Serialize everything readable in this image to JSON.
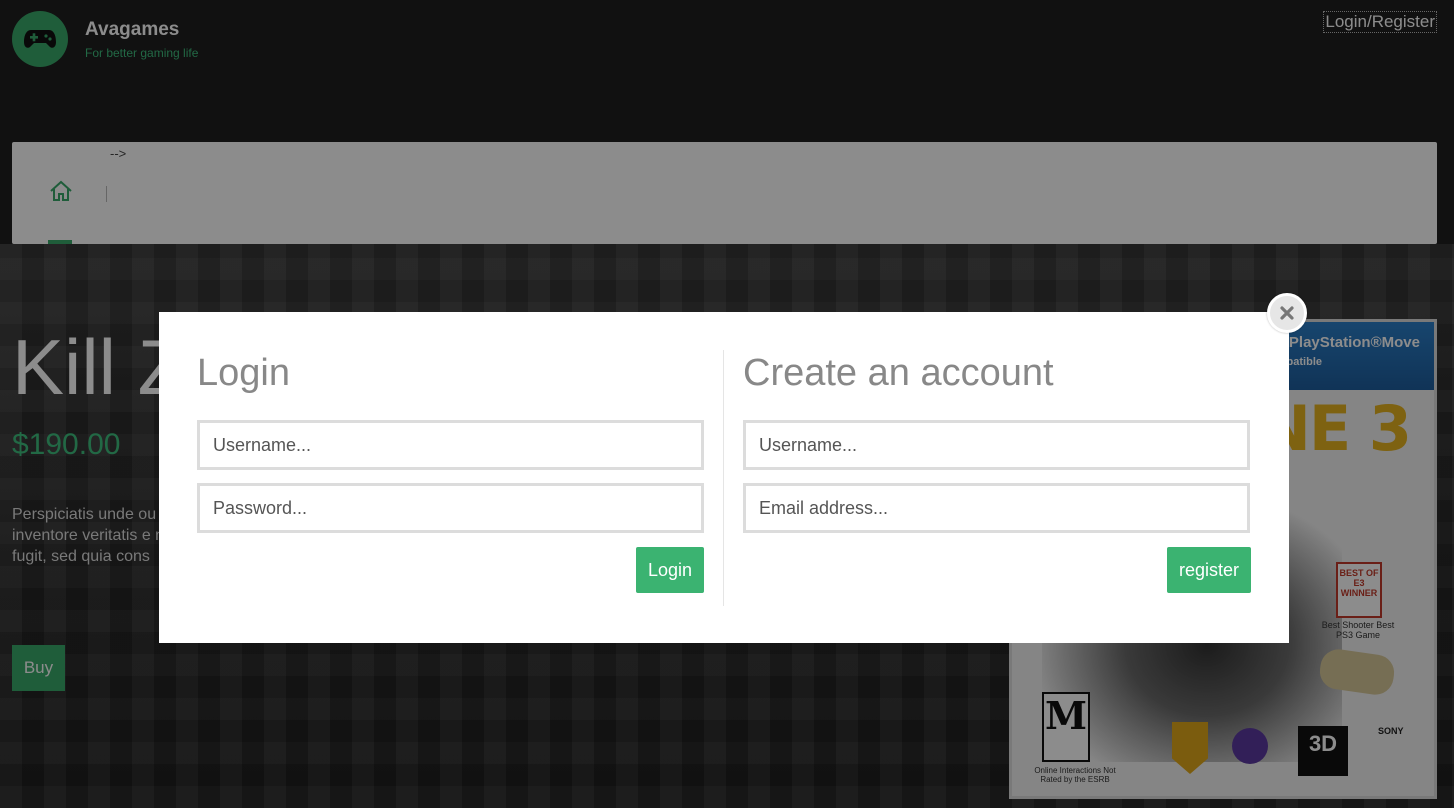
{
  "header": {
    "brand_name": "Avagames",
    "tagline": "For better gaming life",
    "login_register": "Login/Register"
  },
  "navbar": {
    "stray_text": "-->",
    "home_icon": "home-icon"
  },
  "product": {
    "title": "Kill Z",
    "price": "$190.00",
    "description": "Perspiciatis unde ou doloremque laudan inventore veritatis e nemo enim ipsam v fugit, sed quia cons",
    "buy_label": "Buy"
  },
  "cover": {
    "move_label": "PlayStation®Move",
    "move_sub": "Compatible",
    "title_fragment": "NE 3",
    "badge": "BEST OF E3 WINNER",
    "badge_sub": "Best Shooter\nBest PS3 Game",
    "esrb_rating": "M",
    "esrb_label": "Online Interactions Not Rated by the ESRB",
    "compat_3d": "3D"
  },
  "modal": {
    "login": {
      "heading": "Login",
      "username_placeholder": "Username...",
      "password_placeholder": "Password...",
      "button": "Login"
    },
    "register": {
      "heading": "Create an account",
      "username_placeholder": "Username...",
      "email_placeholder": "Email address...",
      "button": "register"
    }
  },
  "colors": {
    "accent": "#3bb371",
    "page_bg": "#1f1f1f",
    "modal_bg": "#ffffff"
  }
}
